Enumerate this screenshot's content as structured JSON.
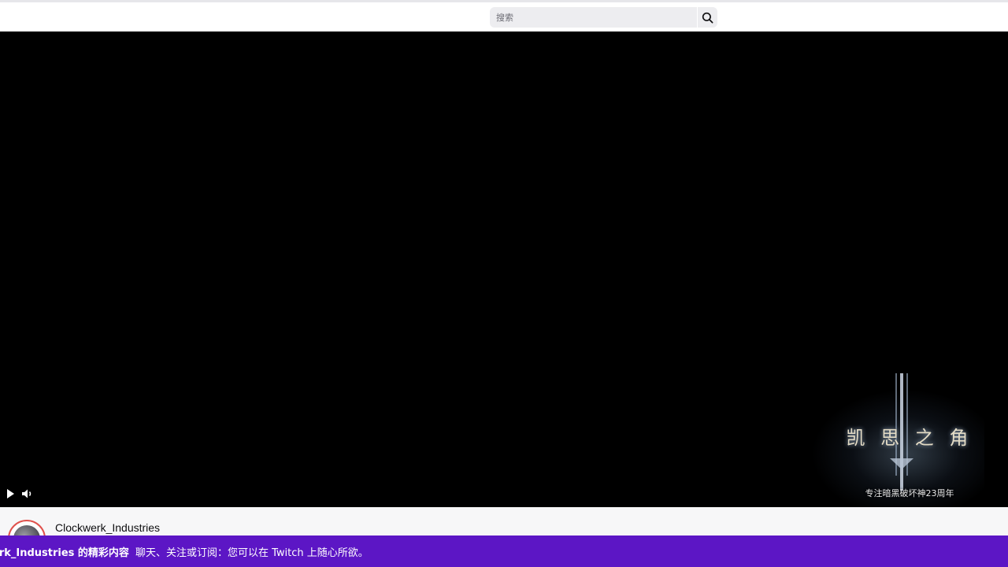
{
  "header": {
    "search": {
      "placeholder": "搜索",
      "value": ""
    },
    "search_button_icon": "search-icon"
  },
  "player": {
    "controls": {
      "play_icon": "play-icon",
      "volume_icon": "volume-icon"
    },
    "promo": {
      "title": "凯 思 之 角",
      "subtitle": "专注暗黑破坏神23周年"
    }
  },
  "channel": {
    "name": "Clockwerk_Industries",
    "avatar_icon": "avatar"
  },
  "banner": {
    "headline": "erk_Industries 的精彩内容",
    "message": "聊天、关注或订阅：您可以在 Twitch 上随心所欲。"
  },
  "colors": {
    "banner_bg": "#5c16c5",
    "player_bg": "#000000",
    "search_bg": "#ededf0"
  }
}
